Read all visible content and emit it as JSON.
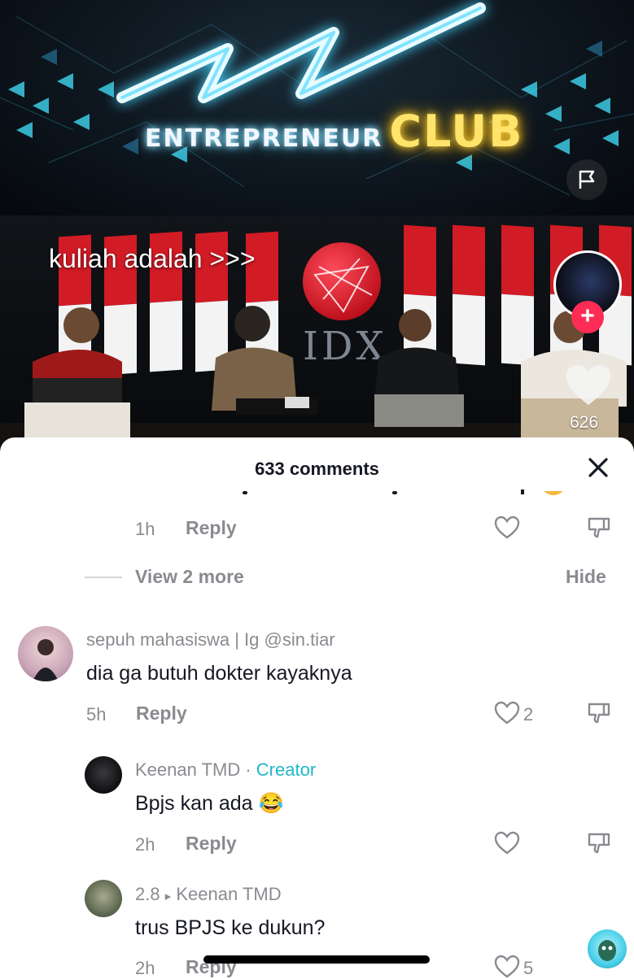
{
  "video": {
    "overlay_caption": "kuliah adalah >>>",
    "banner_word_1": "ENTREPRENEUR",
    "banner_word_2": "CLUB",
    "brand_text": "IDX",
    "like_count": "626",
    "icons": [
      "flag-icon",
      "creator-avatar",
      "follow-plus-icon",
      "heart-icon"
    ]
  },
  "comments_sheet": {
    "title": "633 comments",
    "close_icon": "close-icon",
    "top_reply": {
      "time": "1h",
      "reply_label": "Reply"
    },
    "view_more": "View 2 more",
    "hide": "Hide",
    "comments": [
      {
        "username": "sepuh mahasiswa | Ig @sin.tiar",
        "text": "dia ga butuh dokter kayaknya",
        "time": "5h",
        "reply_label": "Reply",
        "likes": "2"
      },
      {
        "username": "Keenan TMD",
        "separator": " · ",
        "badge": "Creator",
        "text": "Bpjs kan ada 😂",
        "time": "2h",
        "reply_label": "Reply"
      },
      {
        "username": "2.8",
        "reply_to_arrow": "▸",
        "reply_to": "Keenan TMD",
        "text": "trus BPJS ke dukun?",
        "time": "2h",
        "reply_label": "Reply",
        "likes": "5"
      }
    ]
  },
  "colors": {
    "accent_red": "#fe2c55",
    "creator_badge": "#20b8c9",
    "muted_text": "#8a8b91",
    "primary_text": "#161823"
  }
}
